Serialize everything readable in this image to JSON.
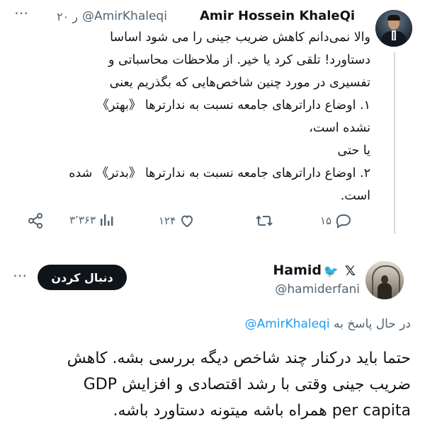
{
  "parent_tweet": {
    "author_name": "Amir Hossein KhaleQi",
    "author_handle": "@AmirKhaleqi",
    "timestamp": "۲۰ ر",
    "more_icon": "⋯",
    "text": "والا نمی‌دانم کاهش ضریب جینی را می شود اساسا\nدستاورد! تلقی کرد یا خیر. از ملاحظات محاسباتی و\nتفسیری در مورد چنین شاخص‌هایی که بگذریم یعنی\n۱. اوضاع داراترهای جامعه نسبت به ندارترها 《بهتر》\nنشده است،\nیا حتی\n۲. اوضاع داراترهای جامعه نسبت به ندارترها 《بدتر》 شده\nاست.",
    "actions": {
      "replies": "۱۵",
      "retweets": "",
      "likes": "۱۲۴",
      "views": "۳٬۳۶۳",
      "share": ""
    },
    "icons": [
      "reply-icon",
      "retweet-icon",
      "like-icon",
      "views-icon",
      "share-icon"
    ]
  },
  "reply_tweet": {
    "author_name": "Hamid",
    "author_badges": "🐦",
    "author_x_badge": "𝕏",
    "author_handle": "@hamiderfani",
    "follow_button": "دنبال کردن",
    "more_icon": "⋯",
    "replying_to_label": "در حال پاسخ به",
    "replying_to_handle": "@AmirKhaleqi",
    "text": "حتما باید درکنار چند شاخص دیگه بررسی بشه. کاهش\nضریب جینی وقتی با رشد اقتصادی و افزایش GDP\nper capita همراه باشه میتونه دستاورد باشه."
  },
  "colors": {
    "text_primary": "#0f1419",
    "text_secondary": "#536471",
    "link": "#1d9bf0",
    "thread_line": "#cfd9de",
    "button_bg": "#0f1419",
    "button_text": "#ffffff"
  }
}
